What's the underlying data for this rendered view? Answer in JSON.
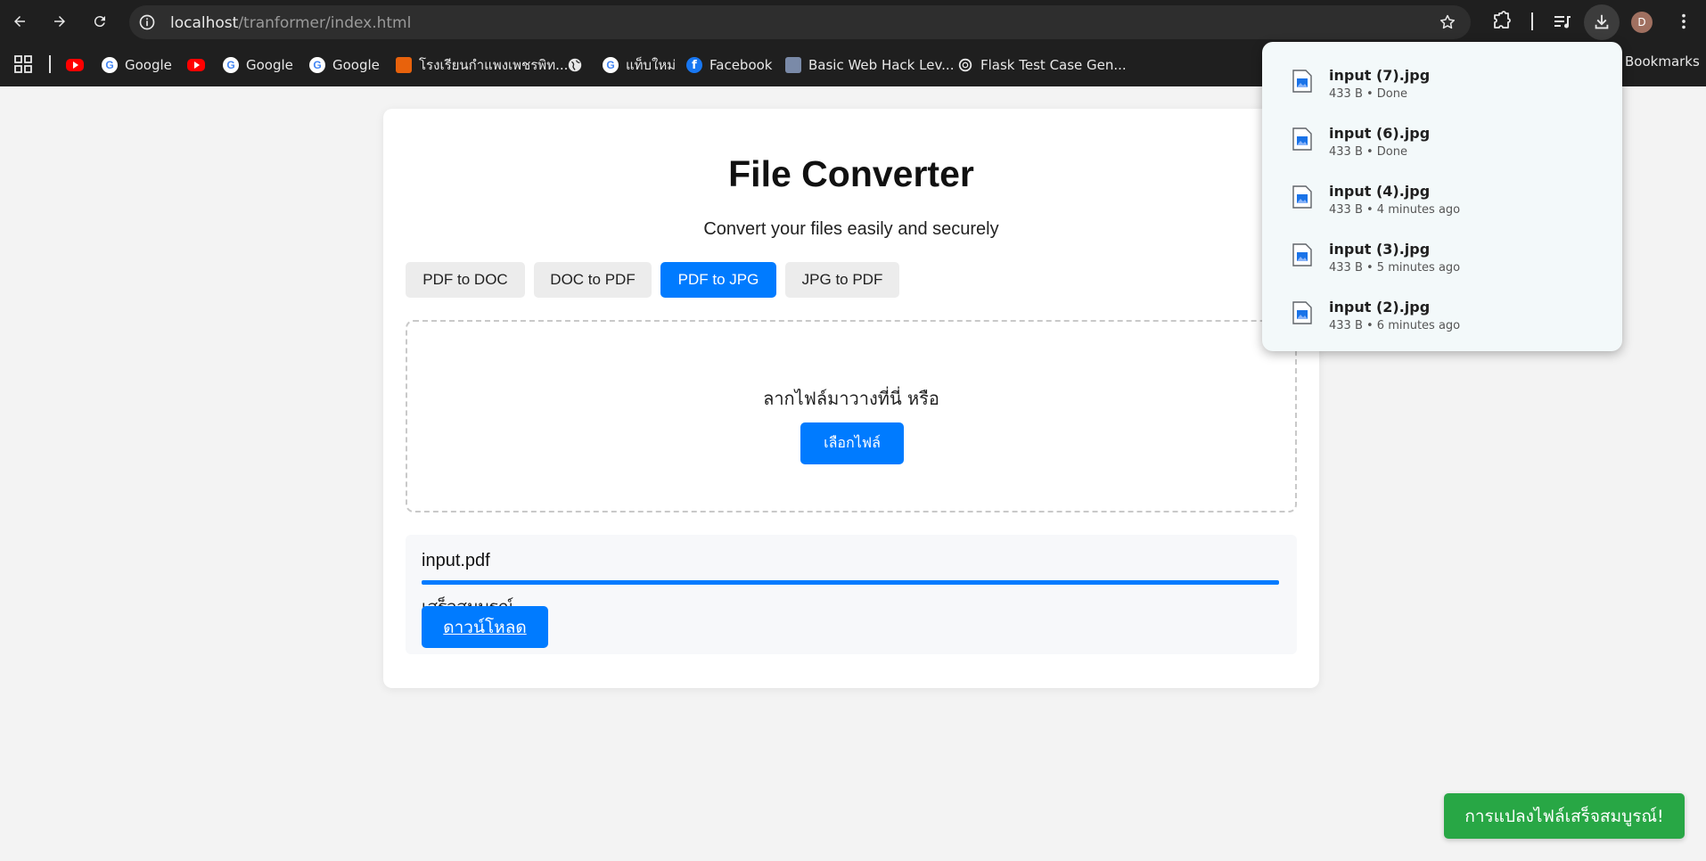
{
  "browser": {
    "url_host": "localhost",
    "url_path": "/tranformer/index.html",
    "avatar_initial": "D",
    "bookmarks": [
      {
        "label": "",
        "icon": "youtube-icon"
      },
      {
        "label": "Google",
        "icon": "google-icon"
      },
      {
        "label": "",
        "icon": "youtube-icon"
      },
      {
        "label": "Google",
        "icon": "google-icon"
      },
      {
        "label": "Google",
        "icon": "google-icon"
      },
      {
        "label": "โรงเรียนกำแพงเพชรพิท...",
        "icon": "school-icon"
      },
      {
        "label": "",
        "icon": "globe-icon"
      },
      {
        "label": "แท็บใหม่",
        "icon": "google-icon"
      },
      {
        "label": "Facebook",
        "icon": "facebook-icon"
      },
      {
        "label": "Basic Web Hack Lev...",
        "icon": "building-icon"
      },
      {
        "label": "Flask Test Case Gen...",
        "icon": "openai-icon"
      }
    ],
    "all_bookmarks_label": "Bookmarks"
  },
  "page": {
    "title": "File Converter",
    "subtitle": "Convert your files easily and securely",
    "tabs": [
      {
        "label": "PDF to DOC",
        "active": false
      },
      {
        "label": "DOC to PDF",
        "active": false
      },
      {
        "label": "PDF to JPG",
        "active": true
      },
      {
        "label": "JPG to PDF",
        "active": false
      }
    ],
    "dropzone": {
      "text": "ลากไฟล์มาวางที่นี่ หรือ",
      "button_label": "เลือกไฟล์"
    },
    "result": {
      "file_name": "input.pdf",
      "progress_fraction": 1.0,
      "status": "เสร็จสมบูรณ์",
      "download_label": "ดาวน์โหลด"
    }
  },
  "downloads": [
    {
      "name": "input (7).jpg",
      "meta": "433 B • Done"
    },
    {
      "name": "input (6).jpg",
      "meta": "433 B • Done"
    },
    {
      "name": "input (4).jpg",
      "meta": "433 B • 4 minutes ago"
    },
    {
      "name": "input (3).jpg",
      "meta": "433 B • 5 minutes ago"
    },
    {
      "name": "input (2).jpg",
      "meta": "433 B • 6 minutes ago"
    }
  ],
  "toast": {
    "text": "การแปลงไฟล์เสร็จสมบูรณ์!"
  },
  "colors": {
    "primary": "#007bff",
    "success": "#28a745",
    "chrome_bg": "#1f1f1f"
  }
}
